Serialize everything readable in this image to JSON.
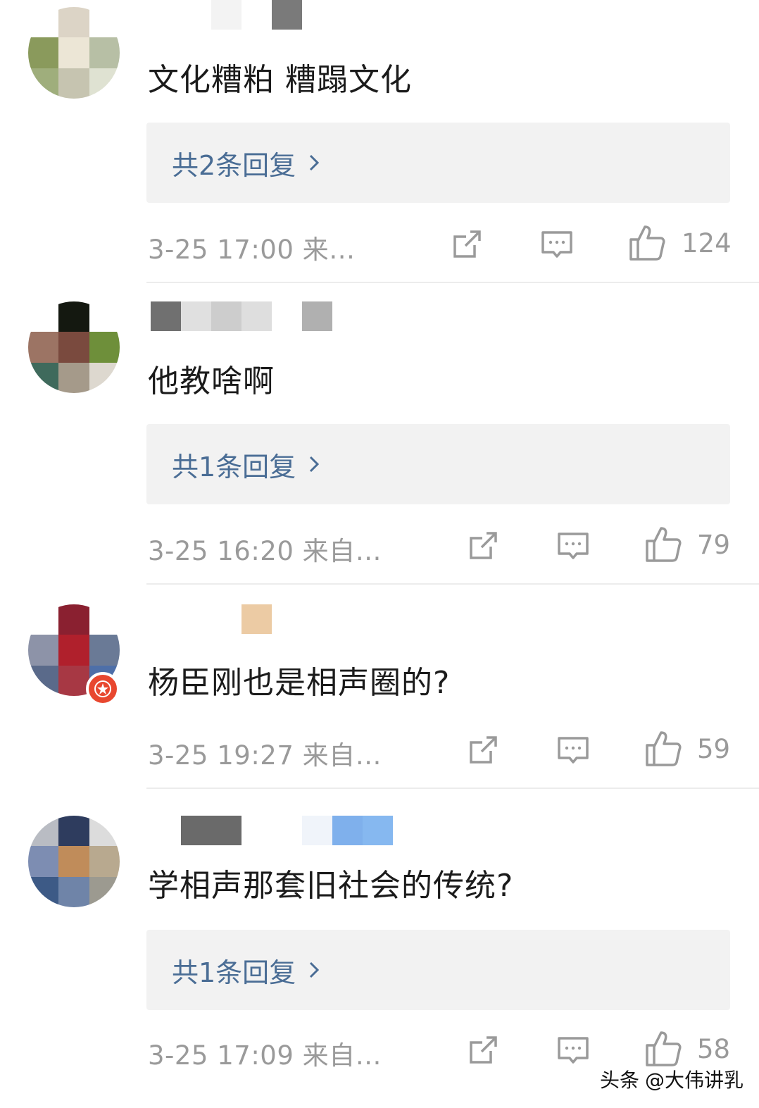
{
  "comments": [
    {
      "text": "文化糟粕 糟蹋文化",
      "reply_label": "共2条回复",
      "meta": "3-25 17:00 来…",
      "likes": "124"
    },
    {
      "text": "他教啥啊",
      "reply_label": "共1条回复",
      "meta": "3-25 16:20 来自…",
      "likes": "79"
    },
    {
      "text": "杨臣刚也是相声圈的?",
      "reply_label": "",
      "meta": "3-25 19:27 来自…",
      "likes": "59"
    },
    {
      "text": "学相声那套旧社会的传统?",
      "reply_label": "共1条回复",
      "meta": "3-25 17:09 来自…",
      "likes": "58"
    }
  ],
  "watermark": {
    "platform": "头条",
    "account": "@大伟讲乳"
  },
  "colors": {
    "reply_link": "#4a6d95",
    "meta_gray": "#9a9a9a",
    "reply_bg": "#f2f2f2",
    "badge": "#e8472f"
  }
}
